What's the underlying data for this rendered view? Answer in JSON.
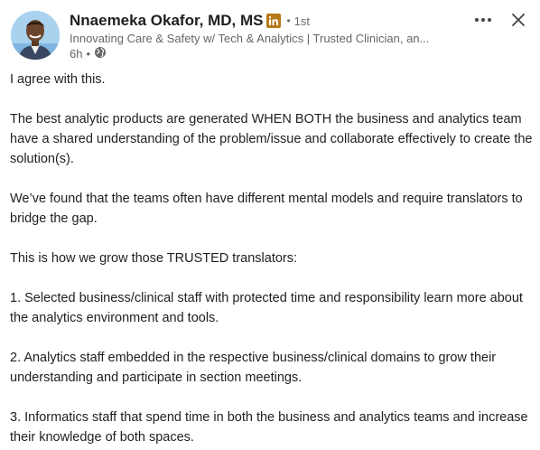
{
  "author": {
    "name": "Nnaemeka Okafor, MD, MS",
    "degree": "1st",
    "headline": "Innovating Care & Safety w/ Tech & Analytics | Trusted Clinician, an...",
    "time": "6h",
    "badge_icon": "linkedin-icon",
    "visibility_icon": "globe-icon"
  },
  "actions": {
    "more_icon": "more-horizontal-icon",
    "close_icon": "close-icon"
  },
  "post": {
    "paragraphs": [
      "I agree with this.",
      "The best analytic products are generated WHEN BOTH the business and analytics team have a shared understanding of the problem/issue and collaborate effectively to create the solution(s).",
      "We’ve found that the teams often have different mental models and require translators to bridge the gap.",
      "This is how we grow those TRUSTED translators:",
      "1. Selected business/clinical staff with protected time and responsibility learn more about the analytics environment and tools.",
      "2. Analytics staff embedded in the respective business/clinical domains to grow their understanding and participate in section meetings.",
      "3. Informatics staff that spend time in both the business and analytics teams and increase their knowledge of both spaces."
    ]
  },
  "colors": {
    "text": "#1f1f1f",
    "secondary": "#666666",
    "badge": "#b87a18"
  }
}
